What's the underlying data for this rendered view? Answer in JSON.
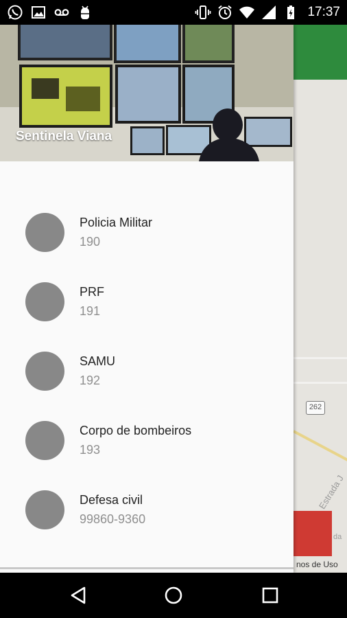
{
  "status_bar": {
    "left_icons": [
      "whatsapp-icon",
      "image-icon",
      "voicemail-icon",
      "android-debug-icon"
    ],
    "right_icons": [
      "vibrate-icon",
      "alarm-icon",
      "wifi-icon",
      "signal-icon",
      "battery-charging-icon"
    ],
    "time": "17:37"
  },
  "drawer": {
    "header_title": "Sentinela Viana",
    "contacts": [
      {
        "name": "Policia Militar",
        "phone": "190"
      },
      {
        "name": "PRF",
        "phone": "191"
      },
      {
        "name": "SAMU",
        "phone": "192"
      },
      {
        "name": "Corpo de bombeiros",
        "phone": "193"
      },
      {
        "name": "Defesa civil",
        "phone": "99860-9360"
      }
    ]
  },
  "map": {
    "road_shield": "262",
    "street_label": "Estrada J",
    "street_label_2": "da",
    "terms": "nos de Uso",
    "accent_green": "#2e8b3d",
    "accent_red": "#cf3a33"
  },
  "nav_bar": {
    "buttons": [
      "back-icon",
      "home-icon",
      "recents-icon"
    ]
  }
}
